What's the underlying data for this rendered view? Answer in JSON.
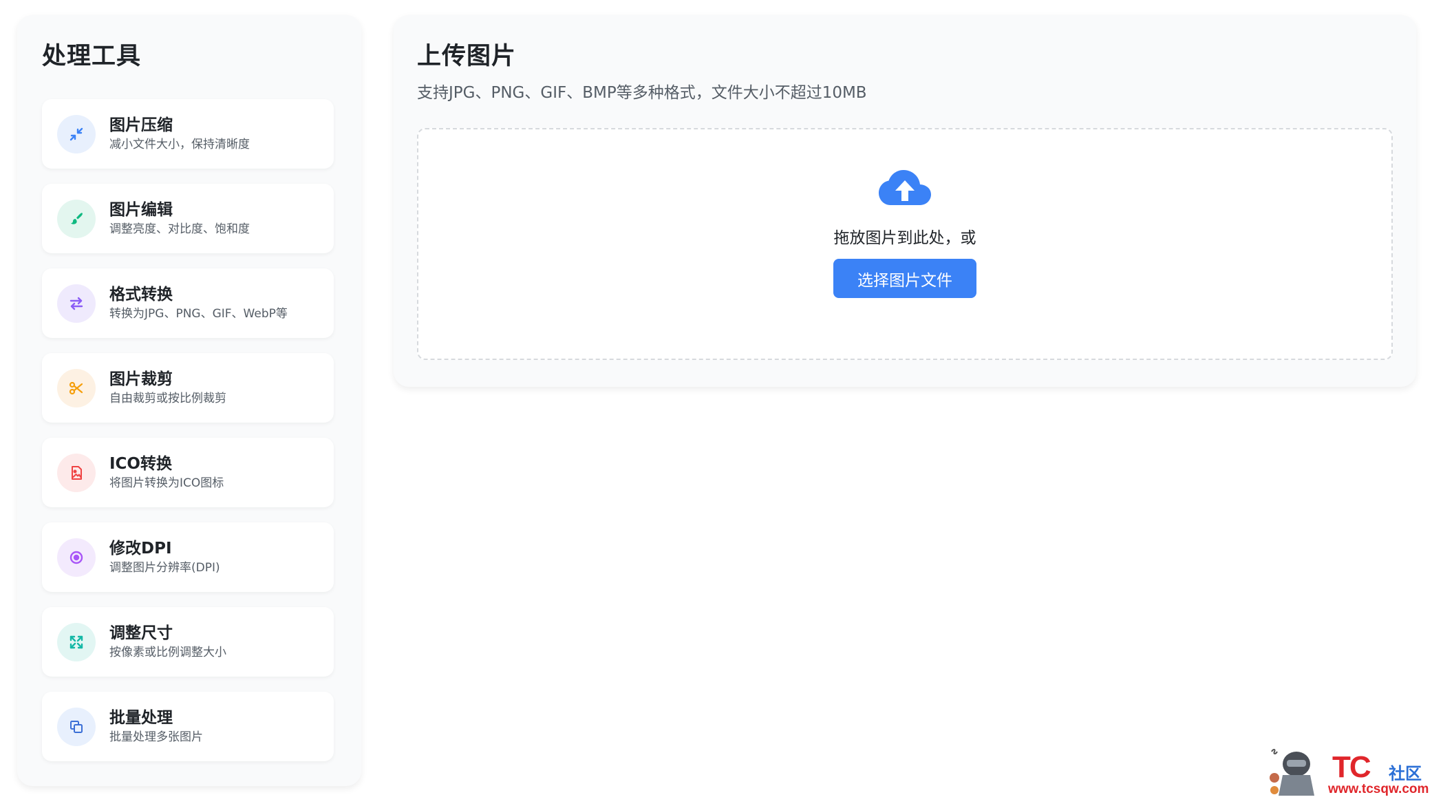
{
  "sidebar": {
    "title": "处理工具",
    "items": [
      {
        "key": "compress",
        "label": "图片压缩",
        "desc": "减小文件大小，保持清晰度",
        "icon": "compress-icon",
        "color": "#3b82f6",
        "bg": "#e8f0fd"
      },
      {
        "key": "edit",
        "label": "图片编辑",
        "desc": "调整亮度、对比度、饱和度",
        "icon": "brush-icon",
        "color": "#10b981",
        "bg": "#e3f6ef"
      },
      {
        "key": "convert",
        "label": "格式转换",
        "desc": "转换为JPG、PNG、GIF、WebP等",
        "icon": "swap-icon",
        "color": "#8b5cf6",
        "bg": "#efeafd"
      },
      {
        "key": "crop",
        "label": "图片裁剪",
        "desc": "自由裁剪或按比例裁剪",
        "icon": "scissors-icon",
        "color": "#f59e0b",
        "bg": "#fdf1e3"
      },
      {
        "key": "ico",
        "label": "ICO转换",
        "desc": "将图片转换为ICO图标",
        "icon": "image-file-icon",
        "color": "#ef4444",
        "bg": "#fdeaea"
      },
      {
        "key": "dpi",
        "label": "修改DPI",
        "desc": "调整图片分辨率(DPI)",
        "icon": "target-icon",
        "color": "#a855f7",
        "bg": "#f3eafd"
      },
      {
        "key": "resize",
        "label": "调整尺寸",
        "desc": "按像素或比例调整大小",
        "icon": "expand-icon",
        "color": "#14b8a6",
        "bg": "#e2f6f3"
      },
      {
        "key": "batch",
        "label": "批量处理",
        "desc": "批量处理多张图片",
        "icon": "copy-icon",
        "color": "#3b6fd6",
        "bg": "#e8f0fd"
      }
    ]
  },
  "main": {
    "title": "上传图片",
    "subtitle": "支持JPG、PNG、GIF、BMP等多种格式，文件大小不超过10MB",
    "dropzone": {
      "icon": "cloud-upload-icon",
      "text": "拖放图片到此处，或",
      "button_label": "选择图片文件",
      "accent": "#3b82f6"
    }
  },
  "watermark": {
    "logo": "TC",
    "community": "社区",
    "url": "www.tcsqw.com"
  }
}
